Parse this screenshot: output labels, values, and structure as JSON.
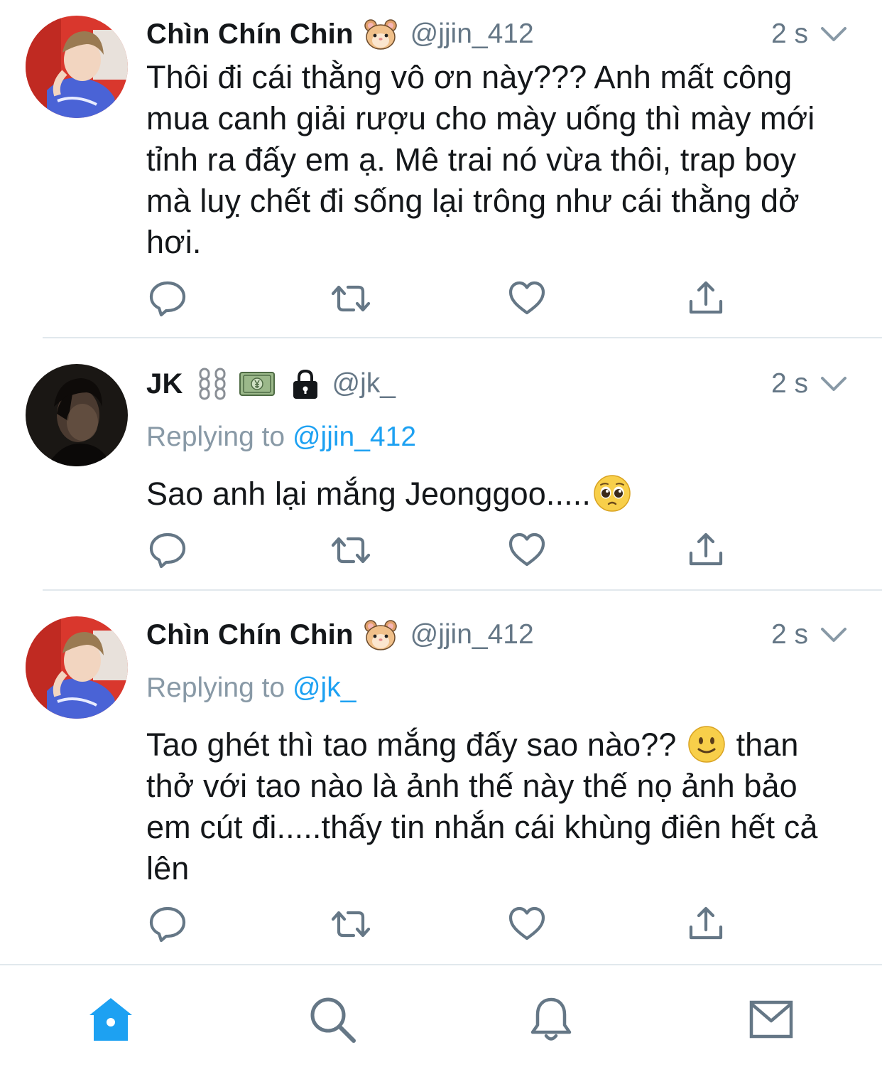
{
  "tweets": [
    {
      "name": "Chìn Chín Chin",
      "name_emoji": "hamster-emoji",
      "handle": "@jjin_412",
      "time": "2 s",
      "replying_prefix": "",
      "replying_to": "",
      "text": "Thôi đi cái thằng vô ơn này??? Anh mất công mua canh giải rượu cho mày uống thì mày mới tỉnh ra đấy em ạ. Mê trai nó vừa thôi, trap boy mà luỵ chết đi sống lại trông như cái thằng dở hơi."
    },
    {
      "name": "JK",
      "name_emoji": "chains-money-lock-emojis",
      "handle": "@jk_",
      "time": "2 s",
      "replying_prefix": "Replying to",
      "replying_to": "@jjin_412",
      "text": "Sao anh lại mắng Jeonggoo.....",
      "text_emoji": "pleading-face-emoji"
    },
    {
      "name": "Chìn Chín Chin",
      "name_emoji": "hamster-emoji",
      "handle": "@jjin_412",
      "time": "2 s",
      "replying_prefix": "Replying to",
      "replying_to": "@jk_",
      "text_before": "Tao ghét thì tao mắng đấy sao nào??",
      "text_emoji": "slightly-smiling-face-emoji",
      "text_after": "than thở với tao nào là ảnh thế này thế nọ ảnh bảo em cút đi.....thấy tin nhắn cái khùng điên hết cả lên"
    }
  ],
  "actions": [
    "reply-icon",
    "retweet-icon",
    "like-icon",
    "share-icon"
  ],
  "tabbar": {
    "items": [
      "home-icon",
      "search-icon",
      "notifications-icon",
      "messages-icon"
    ],
    "active": "home-icon"
  },
  "colors": {
    "text": "#14171a",
    "secondary": "#657786",
    "link": "#1da1f2",
    "divider": "#e1e8ed",
    "icon": "#657786"
  }
}
